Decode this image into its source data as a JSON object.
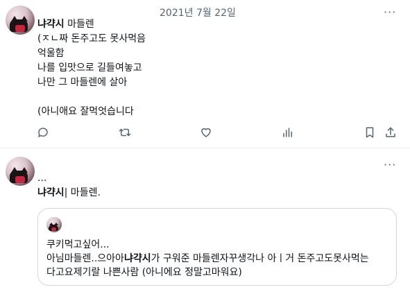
{
  "tweet1": {
    "date": "2021년 7월 22일",
    "more_label": "···",
    "author_name": "냐갹시",
    "first_line_rest": " 마들렌",
    "lines": [
      "(ㅈㄴ짜 돈주고도 못사먹음",
      "억울함",
      "나를 입맛으로 길들여놓고",
      "나만 그 마들렌에 살아",
      "",
      "(아니애요 잘먹엇습니다"
    ],
    "actions": [
      "reply-icon",
      "retweet-icon",
      "like-icon",
      "analytics-icon",
      "bookmark-icon",
      "share-icon"
    ]
  },
  "tweet2": {
    "more_label": "···",
    "first_line": "...",
    "author_name": "냐갹시",
    "second_line_rest": "| 마들렌.",
    "quote": {
      "line1": "쿠키먹고싶어...",
      "line2_pre": "아님마들렌..으아아",
      "line2_name": "냐갹시",
      "line2_post": "가 구워준 마들렌자꾸생각나 아ㅣ거 돈주고도못사먹는",
      "line3": "다고요제기랄 나쁜사람 (아니에요 정말고마워요)"
    }
  }
}
